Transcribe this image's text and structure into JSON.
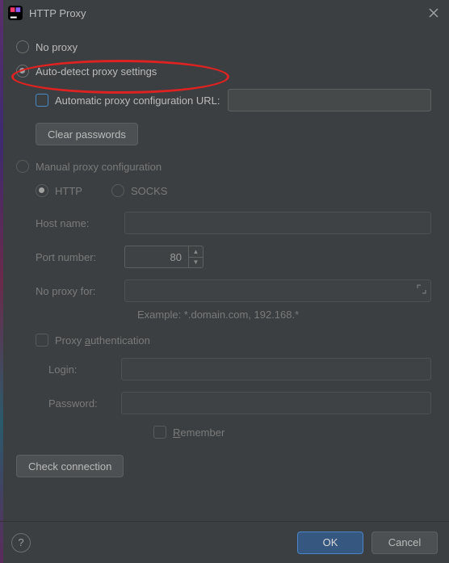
{
  "title": "HTTP Proxy",
  "options": {
    "no_proxy": "No proxy",
    "auto_detect": "Auto-detect proxy settings",
    "manual": "Manual proxy configuration"
  },
  "auto": {
    "pac_label": "Automatic proxy configuration URL:",
    "pac_value": "",
    "clear_passwords": "Clear passwords"
  },
  "manual": {
    "http": "HTTP",
    "socks": "SOCKS",
    "host_label": "Host name:",
    "host_value": "",
    "port_label": "Port number:",
    "port_value": "80",
    "noproxy_label": "No proxy for:",
    "noproxy_value": "",
    "example": "Example: *.domain.com, 192.168.*",
    "auth": {
      "enable": "Proxy authentication",
      "login_label": "Login:",
      "login_value": "",
      "password_label": "Password:",
      "password_value": "",
      "remember": "Remember"
    }
  },
  "actions": {
    "check_connection": "Check connection",
    "ok": "OK",
    "cancel": "Cancel",
    "help": "?"
  }
}
